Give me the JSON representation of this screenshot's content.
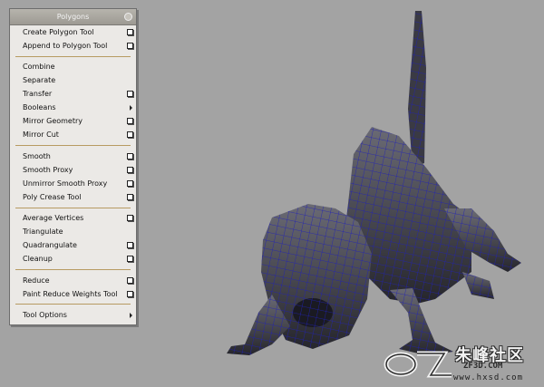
{
  "menu": {
    "title": "Polygons",
    "items": [
      {
        "label": "Create Polygon Tool",
        "has_options": true
      },
      {
        "label": "Append to Polygon Tool",
        "has_options": true
      },
      {
        "label": "Combine",
        "has_options": false
      },
      {
        "label": "Separate",
        "has_options": false
      },
      {
        "label": "Transfer",
        "has_options": true
      },
      {
        "label": "Booleans",
        "has_submenu": true
      },
      {
        "label": "Mirror Geometry",
        "has_options": true
      },
      {
        "label": "Mirror Cut",
        "has_options": true
      },
      {
        "label": "Smooth",
        "has_options": true
      },
      {
        "label": "Smooth Proxy",
        "has_options": true
      },
      {
        "label": "Unmirror Smooth Proxy",
        "has_options": true
      },
      {
        "label": "Poly Crease Tool",
        "has_options": true
      },
      {
        "label": "Average Vertices",
        "has_options": true
      },
      {
        "label": "Triangulate",
        "has_options": false
      },
      {
        "label": "Quadrangulate",
        "has_options": true
      },
      {
        "label": "Cleanup",
        "has_options": true
      },
      {
        "label": "Reduce",
        "has_options": true
      },
      {
        "label": "Paint Reduce Weights Tool",
        "has_options": true
      },
      {
        "label": "Tool Options",
        "has_submenu": true
      }
    ]
  },
  "viewport": {
    "background_color": "#a3a3a3",
    "mesh_wire_color": "#1a1aa6",
    "mesh_shade_color": "#3e3e48"
  },
  "watermark": {
    "cn_text": "朱峰社区",
    "sub_text": "ZF3D.COM",
    "url": "www.hxsd.com"
  }
}
